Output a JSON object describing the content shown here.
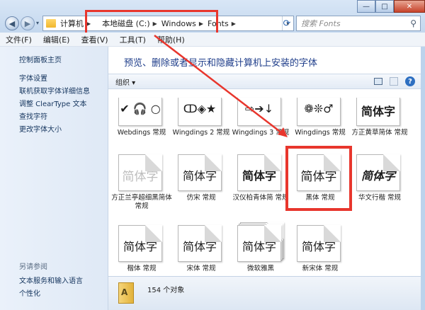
{
  "window": {
    "controls": [
      "—",
      "□",
      "✕"
    ]
  },
  "address": {
    "breadcrumbs": [
      "计算机",
      "本地磁盘 (C:)",
      "Windows",
      "Fonts"
    ],
    "search_placeholder": "搜索 Fonts"
  },
  "menubar": {
    "items": [
      "文件(F)",
      "编辑(E)",
      "查看(V)",
      "工具(T)",
      "帮助(H)"
    ]
  },
  "sidebar": {
    "links": [
      "控制面板主页",
      "字体设置",
      "联机获取字体详细信息",
      "调整 ClearType 文本",
      "查找字符",
      "更改字体大小"
    ],
    "see_also_title": "另请参阅",
    "see_also": [
      "文本服务和输入语言",
      "个性化"
    ]
  },
  "content": {
    "headline": "预览、删除或者显示和隐藏计算机上安装的字体",
    "organize": "组织 ▾"
  },
  "fonts": [
    {
      "name": "Webdings 常规",
      "glyph": "✔ 🎧 ○"
    },
    {
      "name": "Wingdings 2 常规",
      "glyph": "ↀ◈★"
    },
    {
      "name": "Wingdings 3 常规",
      "glyph": "⇨➔↓"
    },
    {
      "name": "Wingdings 常规",
      "glyph": "❁❊♂"
    },
    {
      "name": "方正黄草简体 常规",
      "glyph": "简体字"
    },
    {
      "name": "方正兰亭超细黑简体 常规",
      "glyph": "简体字"
    },
    {
      "name": "仿宋 常规",
      "glyph": "简体字"
    },
    {
      "name": "汉仪柏青体简 常规",
      "glyph": "简体字"
    },
    {
      "name": "黑体 常规",
      "glyph": "简体字"
    },
    {
      "name": "华文行楷 常规",
      "glyph": "简体字"
    },
    {
      "name": "楷体 常规",
      "glyph": "简体字"
    },
    {
      "name": "宋体 常规",
      "glyph": "简体字"
    },
    {
      "name": "微软雅黑",
      "glyph": "简体字"
    },
    {
      "name": "新宋体 常规",
      "glyph": "简体字"
    }
  ],
  "status": {
    "count": "154 个对象"
  },
  "colors": {
    "annotation": "#e8362d",
    "headline": "#1e3d8a"
  }
}
